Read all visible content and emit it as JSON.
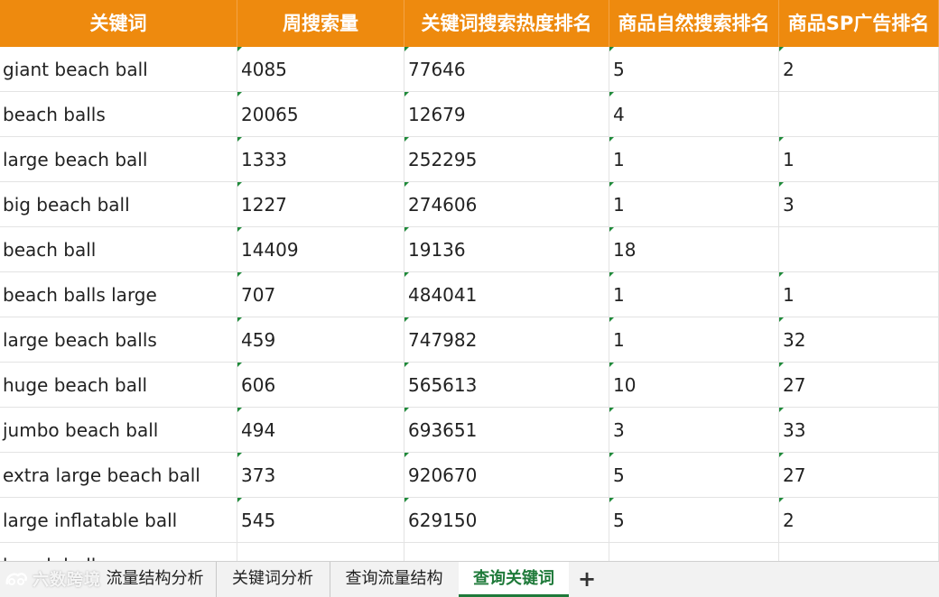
{
  "headers": [
    "关键词",
    "周搜索量",
    "关键词搜索热度排名",
    "商品自然搜索排名",
    "商品SP广告排名"
  ],
  "rows": [
    [
      "giant beach ball",
      "4085",
      "77646",
      "5",
      "2"
    ],
    [
      "beach balls",
      "20065",
      "12679",
      "4",
      ""
    ],
    [
      "large beach ball",
      "1333",
      "252295",
      "1",
      "1"
    ],
    [
      "big beach ball",
      "1227",
      "274606",
      "1",
      "3"
    ],
    [
      "beach ball",
      "14409",
      "19136",
      "18",
      ""
    ],
    [
      "beach balls large",
      "707",
      "484041",
      "1",
      "1"
    ],
    [
      "large beach balls",
      "459",
      "747982",
      "1",
      "32"
    ],
    [
      "huge beach ball",
      "606",
      "565613",
      "10",
      "27"
    ],
    [
      "jumbo beach ball",
      "494",
      "693651",
      "3",
      "33"
    ],
    [
      "extra large beach ball",
      "373",
      "920670",
      "5",
      "27"
    ],
    [
      "large inflatable ball",
      "545",
      "629150",
      "5",
      "2"
    ],
    [
      "beach ball",
      "",
      "",
      "",
      ""
    ]
  ],
  "tabs": [
    "流量结构分析",
    "关键词分析",
    "查询流量结构",
    "查询关键词"
  ],
  "active_tab": "查询关键词",
  "add_tab_label": "+",
  "watermark": "六数跨境",
  "colors": {
    "header_bg": "#EE8A0E",
    "header_text": "#FFFFFF",
    "active_tab": "#1F7A3A",
    "marker": "#1F8A3A"
  }
}
